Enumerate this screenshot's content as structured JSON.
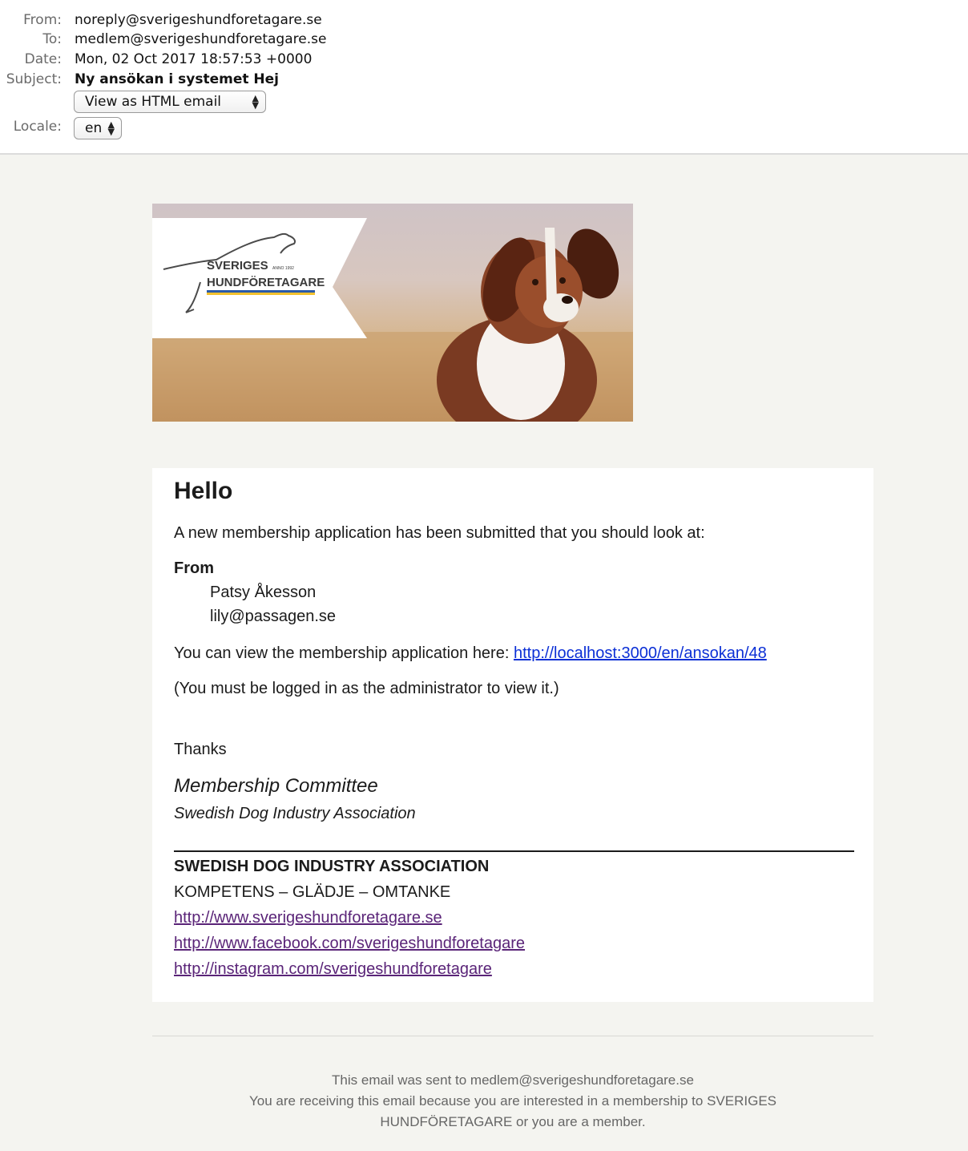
{
  "header": {
    "from_label": "From:",
    "from_value": "noreply@sverigeshundforetagare.se",
    "to_label": "To:",
    "to_value": "medlem@sverigeshundforetagare.se",
    "date_label": "Date:",
    "date_value": "Mon, 02 Oct 2017 18:57:53 +0000",
    "subject_label": "Subject:",
    "subject_value": "Ny ansökan i systemet Hej",
    "view_select_value": "View as HTML email",
    "locale_label": "Locale:",
    "locale_select_value": "en"
  },
  "banner": {
    "logo_line1": "SVERIGES",
    "logo_line2": "HUNDFÖRETAGARE",
    "logo_anno": "ANNO 1992"
  },
  "email": {
    "greeting": "Hello",
    "intro": "A new membership application has been submitted that you should look at:",
    "from_heading": "From",
    "applicant_name": "Patsy Åkesson",
    "applicant_email": "lily@passagen.se",
    "view_text": "You can view the membership application here: ",
    "view_link": "http://localhost:3000/en/ansokan/48",
    "admin_note": "(You must be logged in as the administrator to view it.)",
    "thanks": "Thanks",
    "signature_name": "Membership Committee",
    "signature_org": "Swedish Dog Industry Association",
    "org_upper": "SWEDISH DOG INDUSTRY ASSOCIATION",
    "motto": "KOMPETENS – GLÄDJE – OMTANKE",
    "links": [
      "http://www.sverigeshundforetagare.se",
      "http://www.facebook.com/sverigeshundforetagare",
      "http://instagram.com/sverigeshundforetagare"
    ]
  },
  "footer": {
    "sent_to": "This email was sent to medlem@sverigeshundforetagare.se",
    "reason": "You are receiving this email because you are interested in a membership to SVERIGES HUNDFÖRETAGARE or you are a member."
  },
  "colors": {
    "background": "#f4f4f0",
    "link_blue": "#0b2fd6",
    "link_purple": "#5a2478",
    "logo_stripe_blue": "#2a5aa8",
    "logo_stripe_yellow": "#f2c12e"
  }
}
